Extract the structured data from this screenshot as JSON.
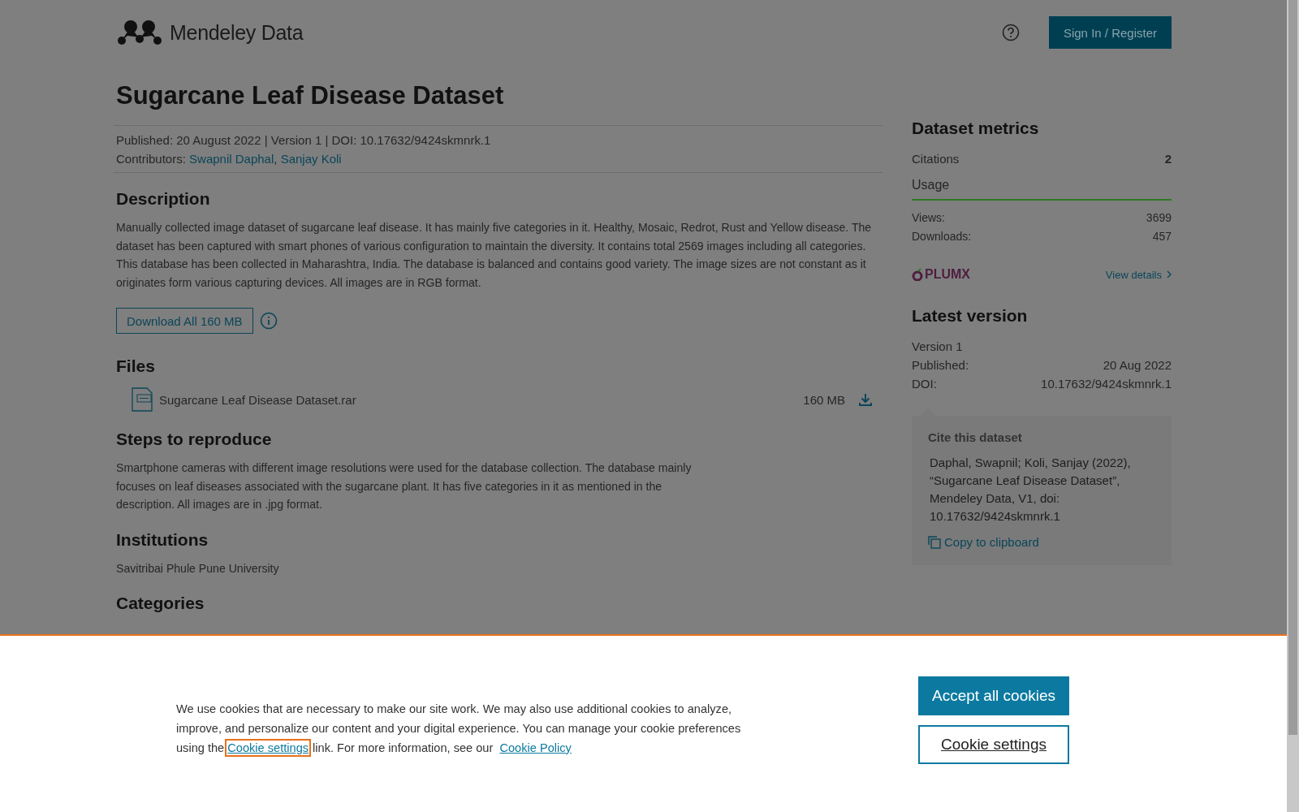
{
  "header": {
    "logo_text": "Mendeley Data",
    "sign_in": "Sign In / Register"
  },
  "title": "Sugarcane Leaf Disease Dataset",
  "meta": {
    "published_line": "Published: 20 August 2022 | Version 1 | DOI: 10.17632/9424skmnrk.1",
    "contributors_label": "Contributors:",
    "contributors": [
      "Swapnil Daphal",
      "Sanjay Koli"
    ],
    "contributors_separator": ","
  },
  "description": {
    "heading": "Description",
    "text": "Manually collected image dataset of sugarcane leaf disease. It has mainly five categories in it. Healthy, Mosaic, Redrot, Rust and Yellow disease. The dataset has been captured with smart phones of various configuration to maintain the diversity. It contains total 2569 images including all categories. This database has been collected in Maharashtra, India. The database is balanced and contains good variety. The image sizes are not constant as it originates form various capturing devices. All images are in RGB format.",
    "download_button": "Download All 160 MB"
  },
  "files": {
    "heading": "Files",
    "items": [
      {
        "name": "Sugarcane Leaf Disease Dataset.rar",
        "size": "160 MB"
      }
    ]
  },
  "steps": {
    "heading": "Steps to reproduce",
    "text": "Smartphone cameras with different image resolutions were used for the database collection. The database mainly focuses on leaf diseases associated with the sugarcane plant. It has five categories in it as mentioned in the description. All images are in .jpg format."
  },
  "institutions": {
    "heading": "Institutions",
    "items": [
      "Savitribai Phule Pune University"
    ]
  },
  "categories": {
    "heading": "Categories"
  },
  "sidebar": {
    "metrics_heading": "Dataset metrics",
    "citations_label": "Citations",
    "citations_value": "2",
    "usage_heading": "Usage",
    "usage": [
      {
        "label": "Views:",
        "value": "3699"
      },
      {
        "label": "Downloads:",
        "value": "457"
      }
    ],
    "plumx": "PLUMX",
    "view_details": "View details",
    "latest_heading": "Latest version",
    "version": "Version 1",
    "published_label": "Published:",
    "published_value": "20 Aug 2022",
    "doi_label": "DOI:",
    "doi_value": "10.17632/9424skmnrk.1",
    "cite_heading": "Cite this dataset",
    "cite_text": "Daphal, Swapnil; Koli, Sanjay (2022), “Sugarcane Leaf Disease Dataset”, Mendeley Data, V1, doi: 10.17632/9424skmnrk.1",
    "copy": "Copy to clipboard"
  },
  "cookie_banner": {
    "text_before": "We use cookies that are necessary to make our site work. We may also use additional cookies to analyze, improve, and personalize our content and your digital experience. You can manage your cookie preferences using the",
    "settings_link": {
      "label": "Cookie settings",
      "focused": true
    },
    "text_after": "link. For more information, see our",
    "policy_link": "Cookie Policy",
    "accept_button": "Accept all cookies",
    "settings_button": "Cookie settings"
  }
}
